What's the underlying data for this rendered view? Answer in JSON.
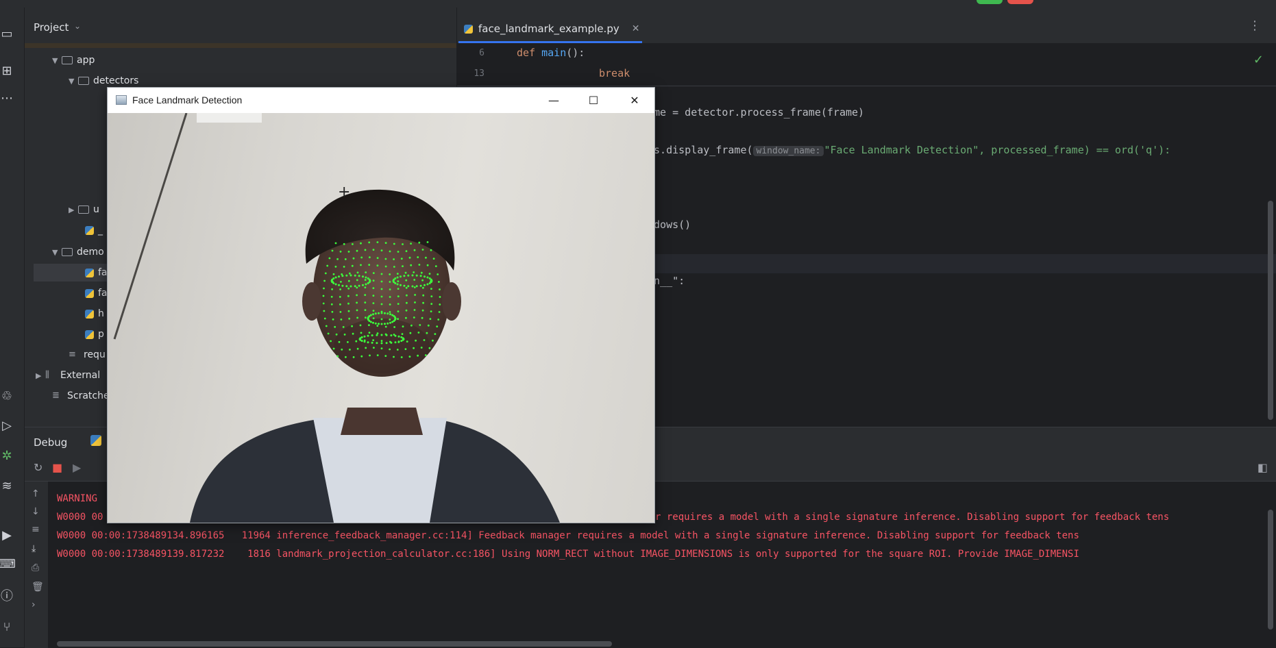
{
  "project": {
    "title": "Project",
    "tree": [
      {
        "label": "app",
        "type": "folder",
        "expanded": true,
        "indent": 1
      },
      {
        "label": "detectors",
        "type": "folder",
        "expanded": true,
        "indent": 2
      },
      {
        "label": "u",
        "type": "folder",
        "expanded": false,
        "indent": 2
      },
      {
        "label": "_",
        "type": "file",
        "indent": 2
      },
      {
        "label": "demo",
        "type": "folder",
        "expanded": true,
        "indent": 1
      },
      {
        "label": "fa",
        "type": "file",
        "indent": 2
      },
      {
        "label": "fa",
        "type": "file",
        "indent": 2
      },
      {
        "label": "h",
        "type": "file",
        "indent": 2
      },
      {
        "label": "p",
        "type": "file",
        "indent": 2
      },
      {
        "label": "requ",
        "type": "text",
        "indent": 1
      },
      {
        "label": "External",
        "type": "lib",
        "indent": 0
      },
      {
        "label": "Scratche",
        "type": "scratch",
        "indent": 0
      }
    ]
  },
  "editor": {
    "tab_label": "face_landmark_example.py",
    "sticky_lines": [
      {
        "num": "6",
        "code": "def main():"
      },
      {
        "num": "13",
        "code": "break"
      }
    ],
    "visible_code": [
      "ame = detector.process_frame(frame)",
      "ls.display_frame(",
      "\"Face Landmark Detection\", processed_frame) == ord('q'):",
      "ndows()",
      "in__\":"
    ],
    "param_hint": "window_name:"
  },
  "debug": {
    "title": "Debug",
    "logs": [
      "WARNING",
      "W0000 00",
      "r requires a model with a single signature inference. Disabling support for feedback tens",
      "W0000 00:00:1738489134.896165   11964 inference_feedback_manager.cc:114] Feedback manager requires a model with a single signature inference. Disabling support for feedback tens",
      "W0000 00:00:1738489139.817232    1816 landmark_projection_calculator.cc:186] Using NORM_RECT without IMAGE_DIMENSIONS is only supported for the square ROI. Provide IMAGE_DIMENSI"
    ]
  },
  "face_window": {
    "title": "Face Landmark Detection",
    "minimize": "—",
    "maximize": "☐",
    "close": "✕"
  },
  "colors": {
    "landmark": "#3cff3c",
    "accent": "#3574f0",
    "error_text": "#f75464"
  }
}
